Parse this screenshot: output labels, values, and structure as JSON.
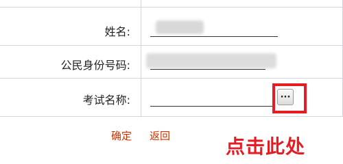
{
  "form": {
    "name_label": "姓名:",
    "id_label": "公民身份号码:",
    "exam_label": "考试名称:",
    "browse_button_label": "···"
  },
  "actions": {
    "confirm_label": "确定",
    "back_label": "返回"
  },
  "annotation": {
    "callout_text": "点击此处",
    "color": "#e51c23"
  }
}
